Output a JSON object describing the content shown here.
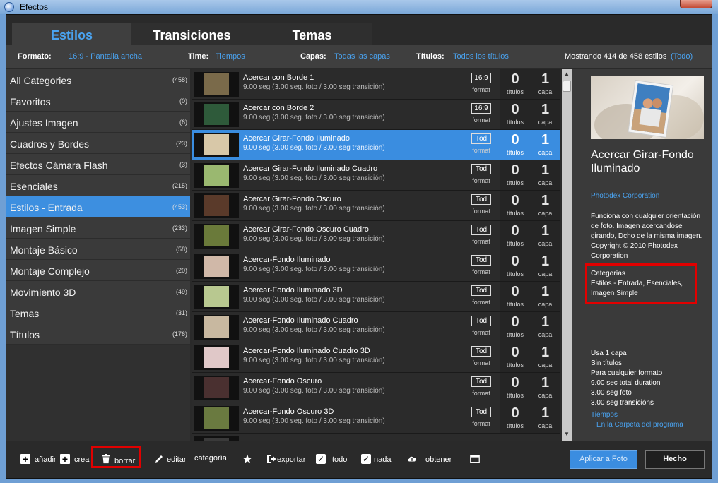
{
  "window": {
    "title": "Efectos"
  },
  "tabs": [
    {
      "label": "Estilos",
      "active": true
    },
    {
      "label": "Transiciones",
      "active": false
    },
    {
      "label": "Temas",
      "active": false
    }
  ],
  "filters": {
    "format_label": "Formato:",
    "format_value": "16:9 - Pantalla ancha",
    "time_label": "Time:",
    "time_value": "Tiempos",
    "layers_label": "Capas:",
    "layers_value": "Todas las capas",
    "titles_label": "Títulos:",
    "titles_value": "Todos los títulos",
    "showing": "Mostrando 414 de 458 estilos",
    "all_link": "(Todo)"
  },
  "categories": [
    {
      "label": "All Categories",
      "count": "(458)"
    },
    {
      "label": "Favoritos",
      "count": "(0)"
    },
    {
      "label": "Ajustes Imagen",
      "count": "(6)"
    },
    {
      "label": "Cuadros y Bordes",
      "count": "(23)"
    },
    {
      "label": "Efectos Cámara Flash",
      "count": "(3)"
    },
    {
      "label": "Esenciales",
      "count": "(215)"
    },
    {
      "label": "Estilos - Entrada",
      "count": "(453)",
      "selected": true
    },
    {
      "label": "Imagen Simple",
      "count": "(233)"
    },
    {
      "label": "Montaje Básico",
      "count": "(58)"
    },
    {
      "label": "Montaje Complejo",
      "count": "(20)"
    },
    {
      "label": "Movimiento 3D",
      "count": "(49)"
    },
    {
      "label": "Temas",
      "count": "(31)"
    },
    {
      "label": "Títulos",
      "count": "(176)"
    }
  ],
  "list_labels": {
    "format": "format",
    "titles": "títulos",
    "layers": "capa"
  },
  "styles": [
    {
      "title": "Acercar con Borde 1",
      "sub": "9.00 seg (3.00 seg. foto / 3.00 seg transición)",
      "fmt": "16:9",
      "titles": "0",
      "layers": "1",
      "thumb": "#7a6a4a"
    },
    {
      "title": "Acercar con Borde 2",
      "sub": "9.00 seg (3.00 seg. foto / 3.00 seg transición)",
      "fmt": "16:9",
      "titles": "0",
      "layers": "1",
      "thumb": "#2e5a3a"
    },
    {
      "title": "Acercar Girar-Fondo Iluminado",
      "sub": "9.00 seg (3.00 seg. foto / 3.00 seg transición)",
      "fmt": "Tod",
      "titles": "0",
      "layers": "1",
      "thumb": "#d8c8a8",
      "selected": true
    },
    {
      "title": "Acercar Girar-Fondo Iluminado Cuadro",
      "sub": "9.00 seg (3.00 seg. foto / 3.00 seg transición)",
      "fmt": "Tod",
      "titles": "0",
      "layers": "1",
      "thumb": "#9ab870"
    },
    {
      "title": "Acercar Girar-Fondo Oscuro",
      "sub": "9.00 seg (3.00 seg. foto / 3.00 seg transición)",
      "fmt": "Tod",
      "titles": "0",
      "layers": "1",
      "thumb": "#5a3a2a"
    },
    {
      "title": "Acercar Girar-Fondo Oscuro Cuadro",
      "sub": "9.00 seg (3.00 seg. foto / 3.00 seg transición)",
      "fmt": "Tod",
      "titles": "0",
      "layers": "1",
      "thumb": "#6a7a3a"
    },
    {
      "title": "Acercar-Fondo Iluminado",
      "sub": "9.00 seg (3.00 seg. foto / 3.00 seg transición)",
      "fmt": "Tod",
      "titles": "0",
      "layers": "1",
      "thumb": "#d0b8a8"
    },
    {
      "title": "Acercar-Fondo Iluminado 3D",
      "sub": "9.00 seg (3.00 seg. foto / 3.00 seg transición)",
      "fmt": "Tod",
      "titles": "0",
      "layers": "1",
      "thumb": "#b8c890"
    },
    {
      "title": "Acercar-Fondo Iluminado Cuadro",
      "sub": "9.00 seg (3.00 seg. foto / 3.00 seg transición)",
      "fmt": "Tod",
      "titles": "0",
      "layers": "1",
      "thumb": "#c8b8a0"
    },
    {
      "title": "Acercar-Fondo Iluminado Cuadro 3D",
      "sub": "9.00 seg (3.00 seg. foto / 3.00 seg transición)",
      "fmt": "Tod",
      "titles": "0",
      "layers": "1",
      "thumb": "#e0c8c8"
    },
    {
      "title": "Acercar-Fondo Oscuro",
      "sub": "9.00 seg (3.00 seg. foto / 3.00 seg transición)",
      "fmt": "Tod",
      "titles": "0",
      "layers": "1",
      "thumb": "#4a3030"
    },
    {
      "title": "Acercar-Fondo Oscuro 3D",
      "sub": "9.00 seg (3.00 seg. foto / 3.00 seg transición)",
      "fmt": "Tod",
      "titles": "0",
      "layers": "1",
      "thumb": "#6a7a40"
    },
    {
      "title": "",
      "sub": "",
      "fmt": "",
      "titles": "",
      "layers": "",
      "thumb": "#3a3a3a"
    }
  ],
  "details": {
    "title": "Acercar Girar-Fondo Iluminado",
    "author": "Photodex Corporation",
    "description": "Funciona con cualquier orientación de foto. Imagen acercandose girando, Dcho de la misma imagen. Copyright © 2010 Photodex Corporation",
    "categories_heading": "Categorías",
    "categories_text": "Estilos - Entrada, Esenciales, Imagen Simple",
    "info": [
      "Usa  1 capa",
      "Sin títulos",
      "Para cualquier formato",
      "9.00 sec total duration",
      "3.00 seg foto",
      "3.00 seg transicións"
    ],
    "link1": "Tiempos",
    "link2": "En la Carpeta del programa"
  },
  "toolbar": {
    "add": "añadir",
    "create": "crea",
    "delete": "borrar",
    "edit": "editar",
    "category": "categoría",
    "export": "exportar",
    "all": "todo",
    "none": "nada",
    "get": "obtener"
  },
  "buttons": {
    "apply": "Aplicar a Foto",
    "done": "Hecho"
  },
  "colors": {
    "accent": "#3d8fe0",
    "link": "#4aa3f0",
    "highlight": "#e10000"
  }
}
